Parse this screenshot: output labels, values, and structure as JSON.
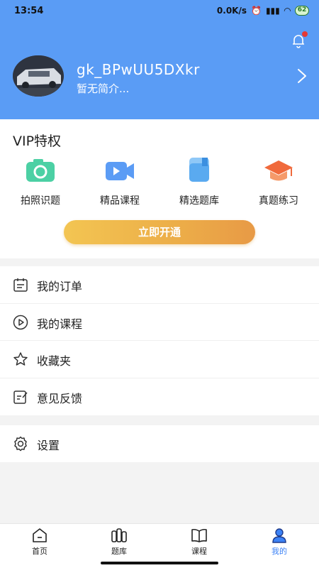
{
  "status_bar": {
    "time": "13:54",
    "speed": "0.0K/s",
    "battery": "62"
  },
  "profile": {
    "username": "gk_BPwUU5DXkr",
    "bio": "暂无简介..."
  },
  "vip": {
    "title": "VIP特权",
    "items": [
      {
        "label": "拍照识题",
        "icon": "camera-icon",
        "color": "#4cd0a4"
      },
      {
        "label": "精品课程",
        "icon": "video-icon",
        "color": "#5b9cf5"
      },
      {
        "label": "精选题库",
        "icon": "question-bank-icon",
        "color": "#5aaaf0"
      },
      {
        "label": "真题练习",
        "icon": "graduation-cap-icon",
        "color": "#f06a3c"
      }
    ],
    "button_label": "立即开通"
  },
  "menu": {
    "items": [
      {
        "label": "我的订单",
        "icon": "order-icon"
      },
      {
        "label": "我的课程",
        "icon": "play-circle-icon"
      },
      {
        "label": "收藏夹",
        "icon": "star-icon"
      },
      {
        "label": "意见反馈",
        "icon": "feedback-icon"
      }
    ],
    "settings_label": "设置"
  },
  "tabbar": {
    "items": [
      {
        "label": "首页",
        "icon": "home-icon"
      },
      {
        "label": "题库",
        "icon": "books-icon"
      },
      {
        "label": "课程",
        "icon": "open-book-icon"
      },
      {
        "label": "我的",
        "icon": "person-icon"
      }
    ],
    "active_index": 3,
    "accent_color": "#3b82f6"
  },
  "colors": {
    "header_bg": "#5a9cf5",
    "vip_button_start": "#f3c552",
    "vip_button_end": "#e89a46"
  }
}
